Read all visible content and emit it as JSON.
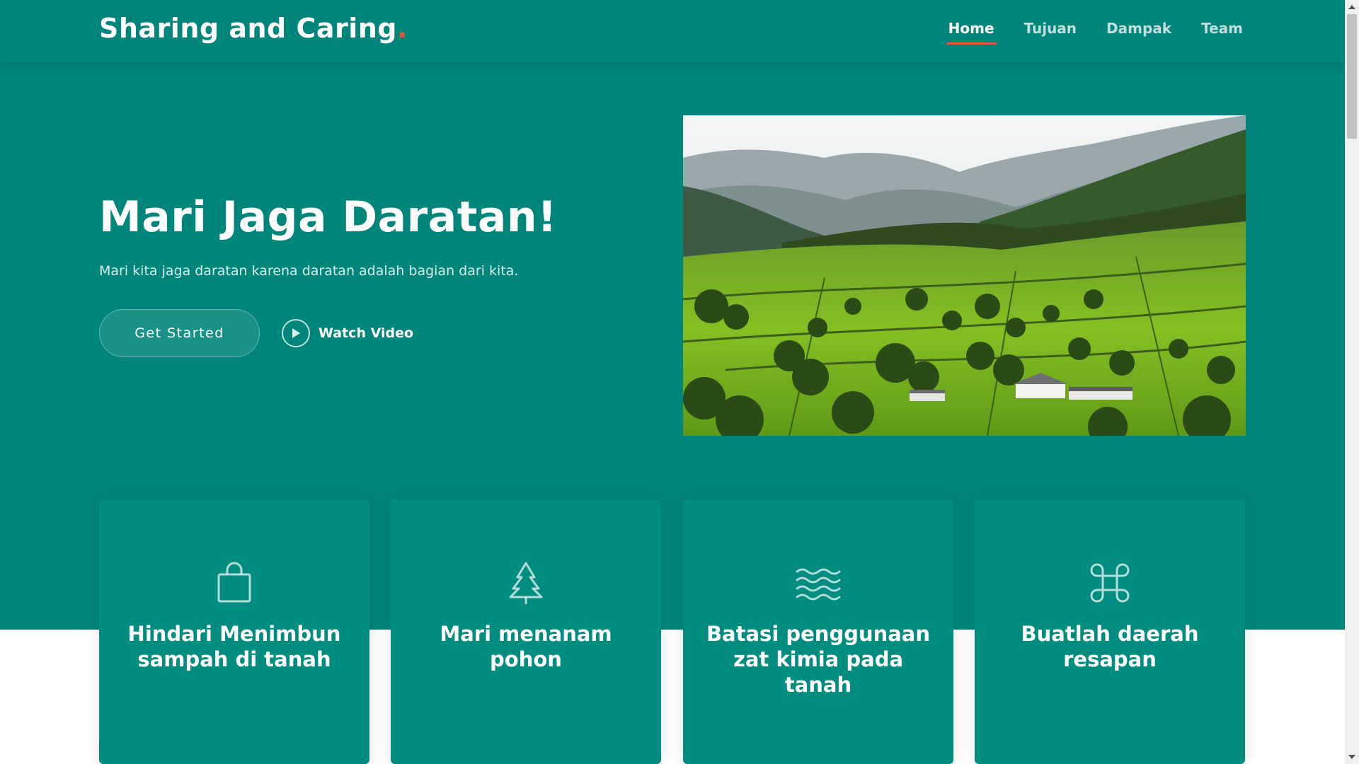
{
  "header": {
    "logo_text": "Sharing and Caring",
    "logo_dot": ".",
    "nav": [
      {
        "label": "Home",
        "active": true
      },
      {
        "label": "Tujuan",
        "active": false
      },
      {
        "label": "Dampak",
        "active": false
      },
      {
        "label": "Team",
        "active": false
      }
    ]
  },
  "hero": {
    "title": "Mari Jaga Daratan!",
    "subtitle": "Mari kita jaga daratan karena daratan adalah bagian dari kita.",
    "primary_button": "Get Started",
    "video_button": "Watch Video",
    "video_icon": "play-circle-icon"
  },
  "cards": [
    {
      "icon": "shopping-bag-icon",
      "title": "Hindari Menimbun sampah di tanah"
    },
    {
      "icon": "tree-icon",
      "title": "Mari menanam pohon"
    },
    {
      "icon": "water-waves-icon",
      "title": "Batasi penggunaan zat kimia pada tanah"
    },
    {
      "icon": "command-icon",
      "title": "Buatlah daerah resapan"
    }
  ],
  "colors": {
    "primary": "#00857a",
    "card": "#008c7e",
    "accent": "#e8553b"
  }
}
